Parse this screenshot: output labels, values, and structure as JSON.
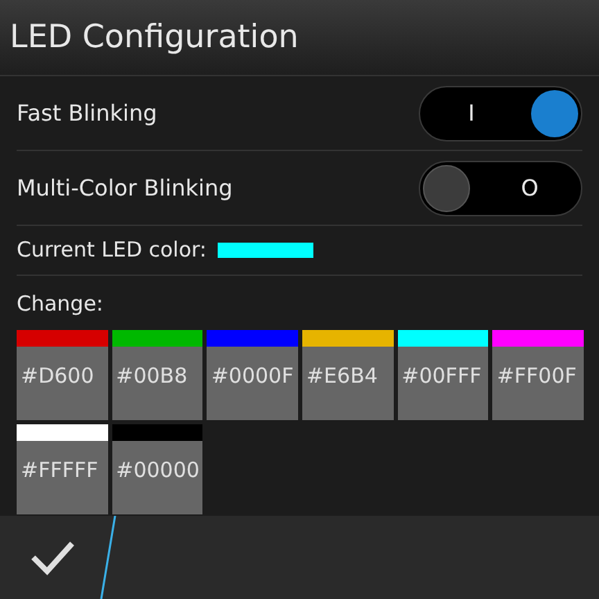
{
  "title": "LED Configuration",
  "toggles": [
    {
      "label": "Fast Blinking",
      "on": true,
      "text": "I"
    },
    {
      "label": "Multi-Color Blinking",
      "on": false,
      "text": "O"
    }
  ],
  "current": {
    "label": "Current LED color:",
    "color": "#00ffff"
  },
  "change_label": "Change:",
  "swatches": [
    {
      "text": "#D600",
      "color": "#d60000"
    },
    {
      "text": "#00B8",
      "color": "#00b800"
    },
    {
      "text": "#0000F",
      "color": "#0000ff"
    },
    {
      "text": "#E6B4",
      "color": "#e6b400"
    },
    {
      "text": "#00FFF",
      "color": "#00ffff"
    },
    {
      "text": "#FF00F",
      "color": "#ff00ff"
    },
    {
      "text": "#FFFFF",
      "color": "#ffffff"
    },
    {
      "text": "#00000",
      "color": "#000000"
    }
  ]
}
